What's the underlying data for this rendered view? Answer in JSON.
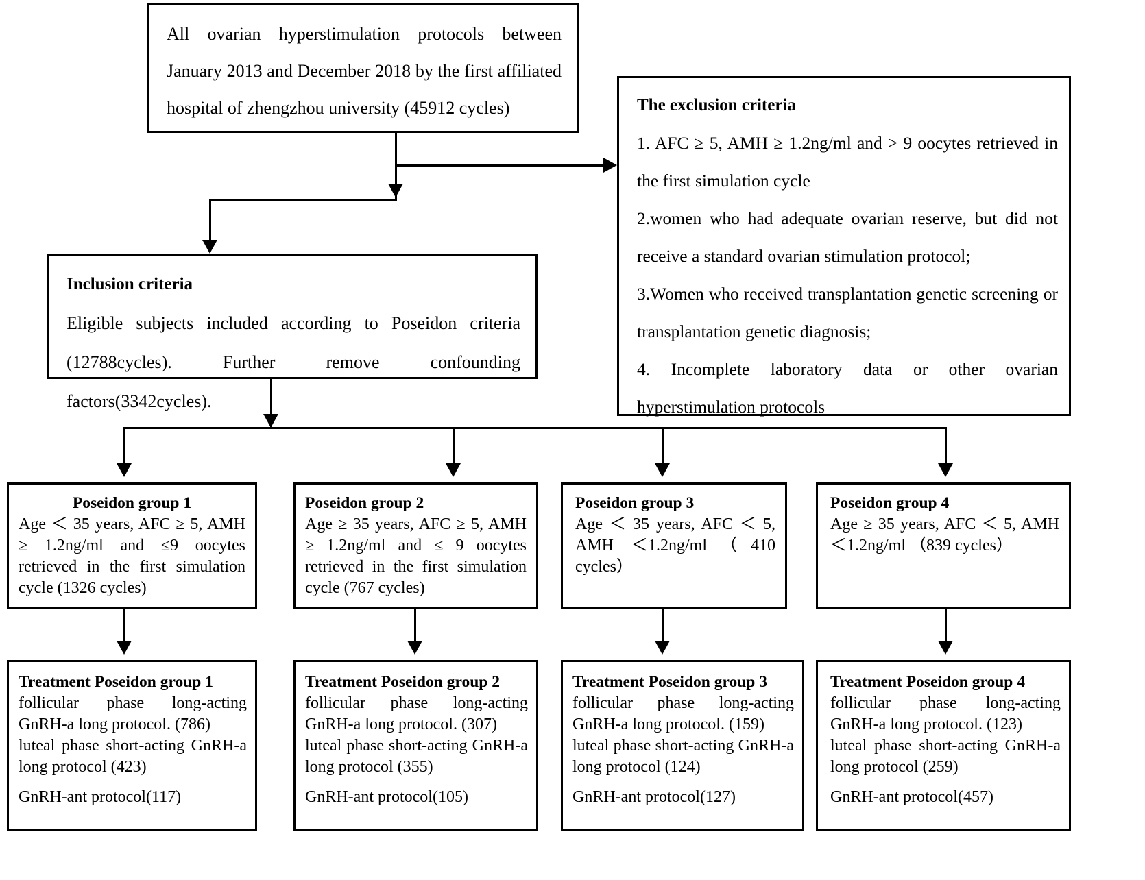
{
  "source_box": {
    "text": "All ovarian hyperstimulation protocols between January 2013 and December 2018 by the first affiliated hospital of zhengzhou university (45912 cycles)"
  },
  "exclusion_box": {
    "title": "The exclusion criteria",
    "items": [
      "1. AFC ≥ 5, AMH ≥ 1.2ng/ml and > 9 oocytes retrieved in the first simulation cycle",
      "2.women who had adequate ovarian reserve, but did not receive a standard ovarian stimulation protocol;",
      "3.Women who received transplantation genetic screening or transplantation genetic diagnosis;",
      "4. Incomplete laboratory data or other ovarian hyperstimulation protocols"
    ]
  },
  "inclusion_box": {
    "title": "Inclusion criteria",
    "text": "Eligible subjects included according to Poseidon criteria (12788cycles). Further remove confounding factors(3342cycles)."
  },
  "groups": [
    {
      "title": "Poseidon group 1",
      "text": "Age ＜ 35 years, AFC ≥ 5, AMH ≥ 1.2ng/ml and ≤9 oocytes retrieved in the first simulation cycle (1326 cycles)"
    },
    {
      "title": "Poseidon group 2",
      "text": "Age ≥ 35 years, AFC ≥ 5, AMH ≥ 1.2ng/ml and ≤ 9 oocytes retrieved in the first simulation cycle (767 cycles)"
    },
    {
      "title": "Poseidon group 3",
      "text": "Age ＜ 35 years, AFC ＜ 5, AMH ＜1.2ng/ml（410 cycles）"
    },
    {
      "title": "Poseidon group 4",
      "text": "Age ≥ 35 years, AFC ＜ 5, AMH ＜1.2ng/ml （839 cycles）"
    }
  ],
  "treatments": [
    {
      "title": "Treatment Poseidon group 1",
      "line1": "follicular phase long-acting GnRH-a long protocol. (786)",
      "line2": "luteal phase short-acting GnRH-a long protocol (423)",
      "line3": "GnRH-ant protocol(117)"
    },
    {
      "title": "Treatment Poseidon group 2",
      "line1": "follicular phase long-acting GnRH-a long protocol. (307)",
      "line2": "luteal phase short-acting GnRH-a long protocol (355)",
      "line3": "GnRH-ant protocol(105)"
    },
    {
      "title": "Treatment Poseidon group 3",
      "line1": "follicular phase long-acting GnRH-a long protocol. (159)",
      "line2": "luteal phase short-acting GnRH-a long protocol (124)",
      "line3": "GnRH-ant protocol(127)"
    },
    {
      "title": "Treatment Poseidon group 4",
      "line1": "follicular phase long-acting GnRH-a long protocol. (123)",
      "line2": "luteal phase short-acting GnRH-a long protocol (259)",
      "line3": "GnRH-ant protocol(457)"
    }
  ],
  "colors": {
    "stroke": "#000000",
    "background": "#ffffff"
  }
}
